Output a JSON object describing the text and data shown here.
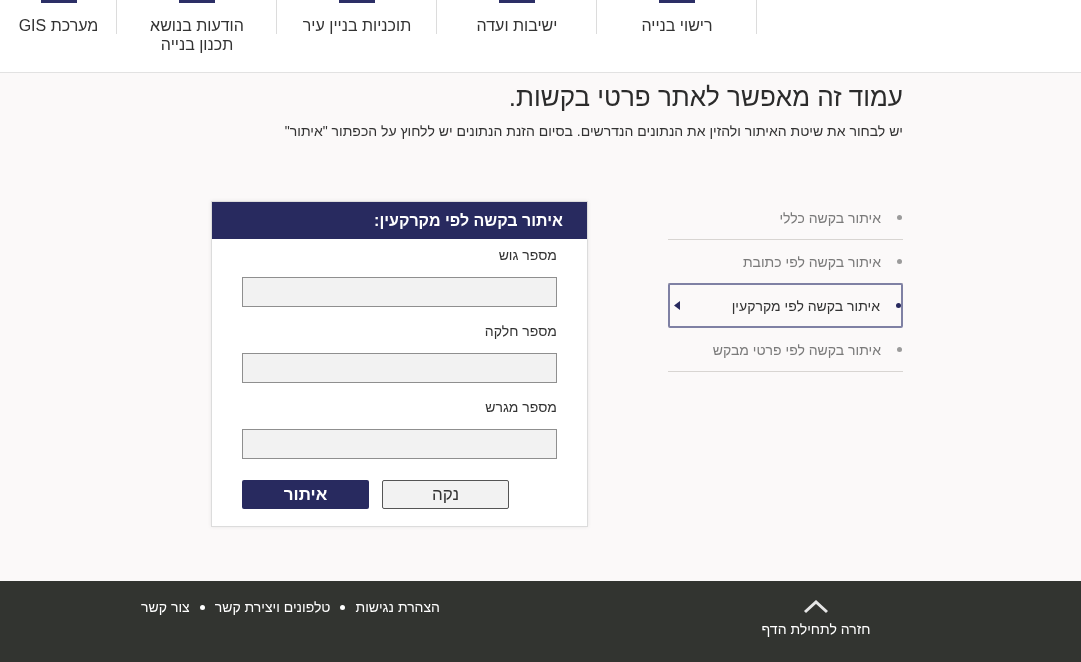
{
  "top_nav": {
    "items": [
      {
        "label": "רישוי בנייה"
      },
      {
        "label": "ישיבות ועדה"
      },
      {
        "label": "תוכניות בניין עיר"
      },
      {
        "label": "הודעות בנושא תכנון בנייה"
      },
      {
        "label": "מערכת GIS"
      }
    ]
  },
  "page_header": {
    "title": "עמוד זה מאפשר לאתר פרטי בקשות.",
    "instructions": "יש לבחור את שיטת האיתור ולהזין את הנתונים הנדרשים. בסיום הזנת הנתונים יש ללחוץ על הכפתור \"איתור\""
  },
  "search_methods": {
    "items": [
      {
        "label": "איתור בקשה כללי",
        "selected": false
      },
      {
        "label": "איתור בקשה לפי כתובת",
        "selected": false
      },
      {
        "label": "איתור בקשה לפי מקרקעין",
        "selected": true
      },
      {
        "label": "איתור בקשה לפי פרטי מבקש",
        "selected": false
      }
    ]
  },
  "search_form": {
    "title": "איתור בקשה לפי מקרקעין:",
    "fields": [
      {
        "label": "מספר גוש"
      },
      {
        "label": "מספר חלקה"
      },
      {
        "label": "מספר מגרש"
      }
    ],
    "buttons": [
      {
        "label": "נקה",
        "kind": "secondary"
      },
      {
        "label": "איתור",
        "kind": "primary"
      }
    ]
  },
  "footer": {
    "back_to_top": "חזרה לתחילת הדף",
    "links": [
      "הצהרת נגישות",
      "טלפונים ויצירת קשר",
      "צור קשר"
    ]
  }
}
